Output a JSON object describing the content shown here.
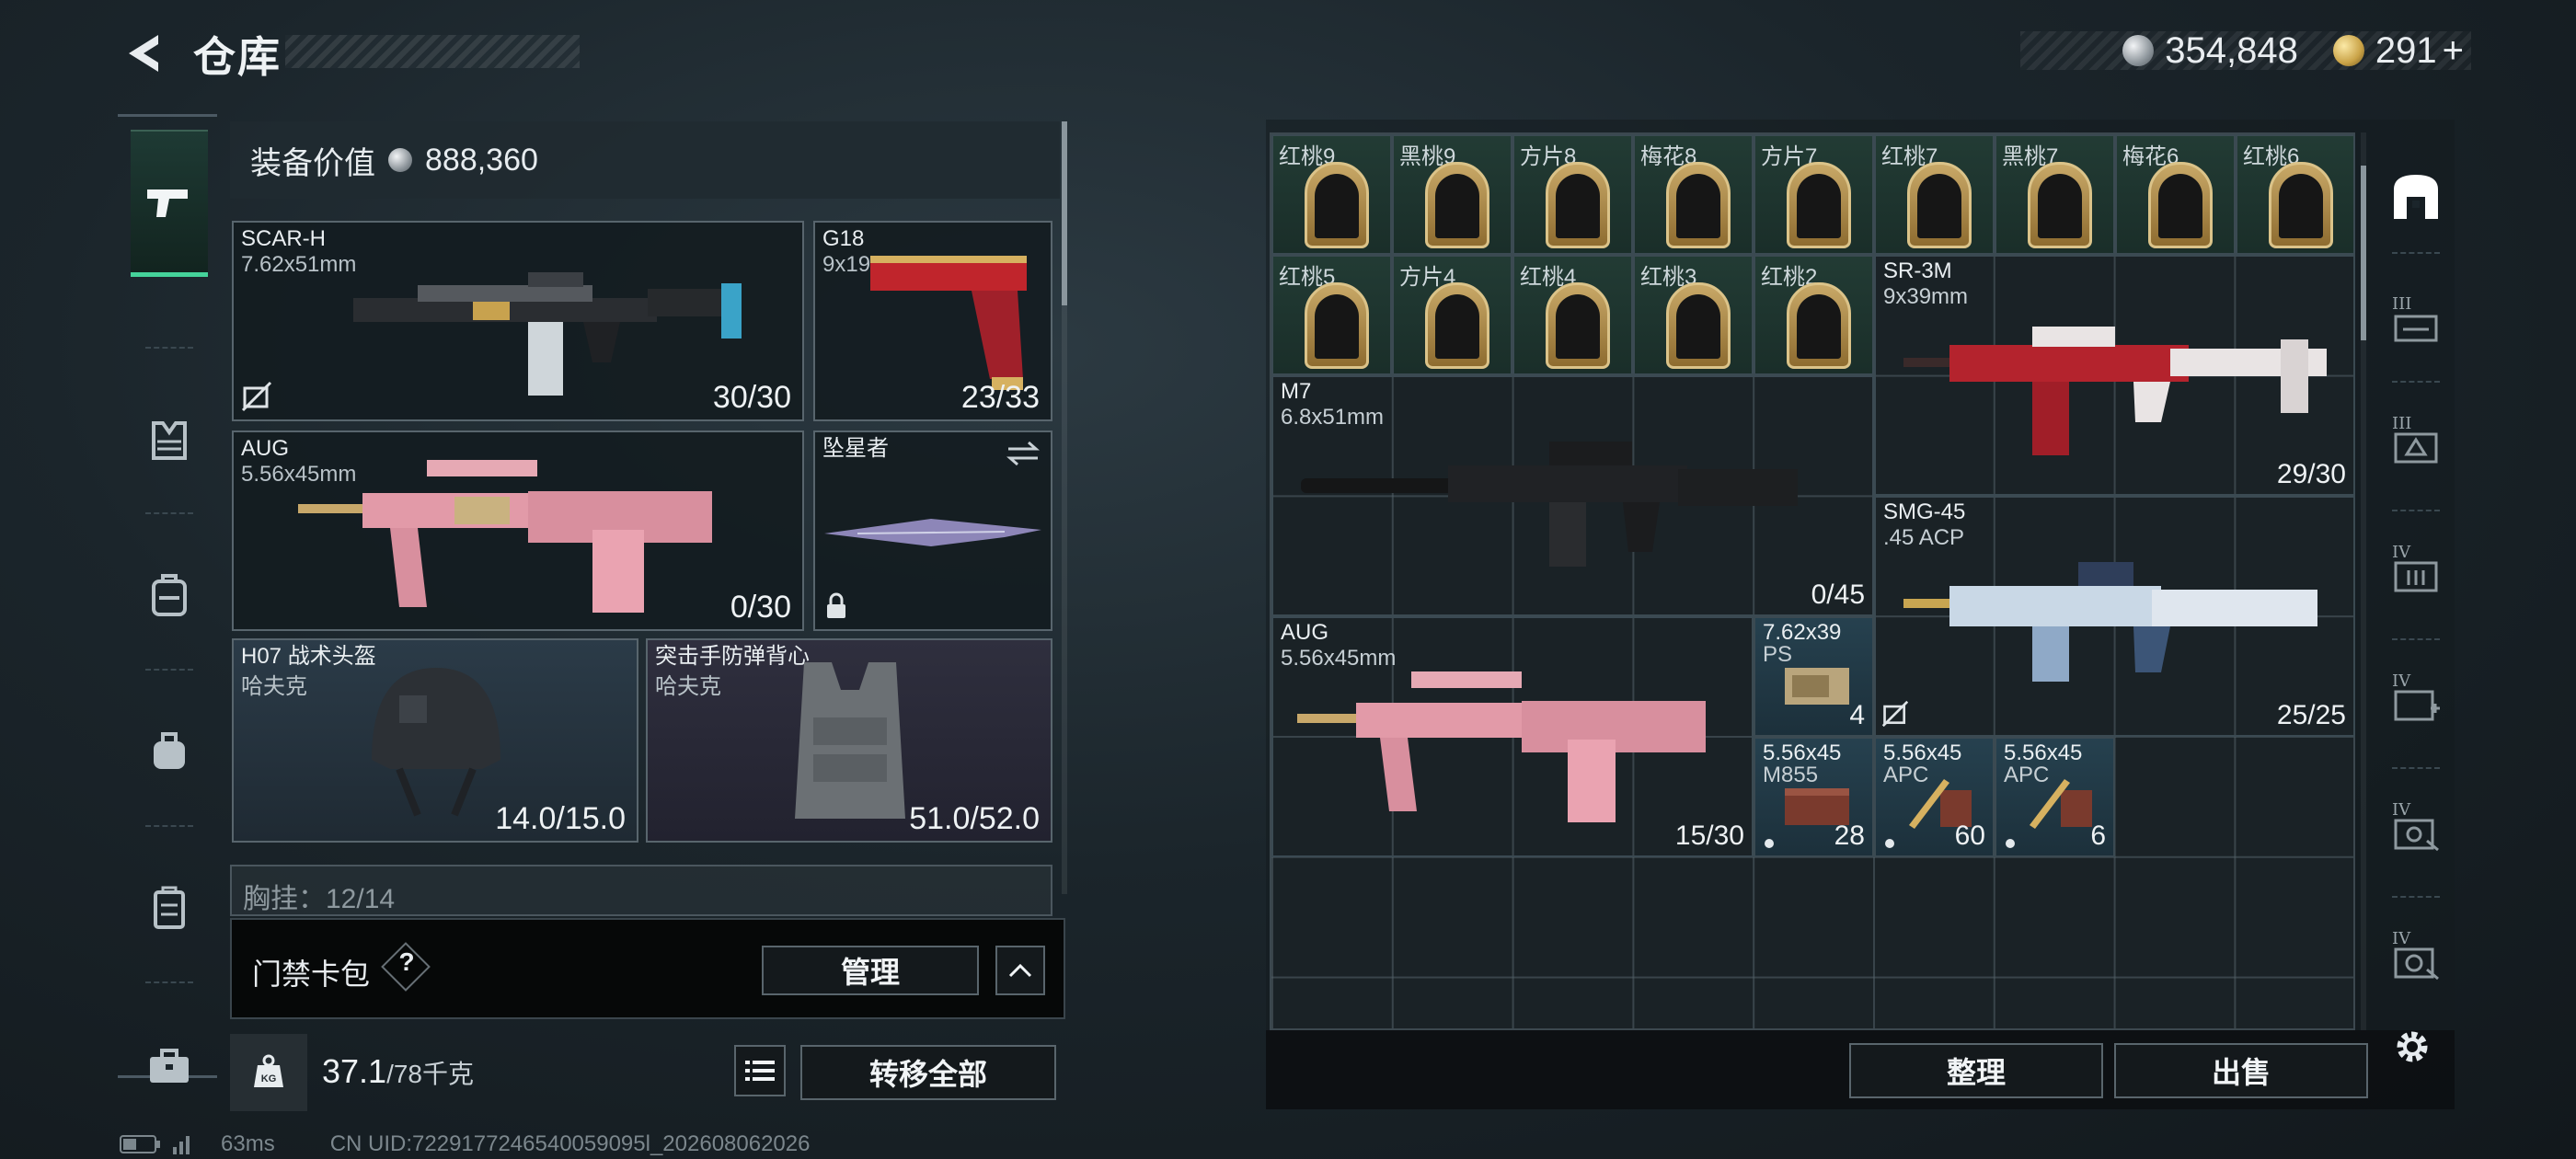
{
  "header": {
    "title": "仓库"
  },
  "currency": {
    "silver": "354,848",
    "gold": "291",
    "gold_plus": "+"
  },
  "equipment": {
    "value_label": "装备价值",
    "value": "888,360",
    "primary": {
      "name": "SCAR-H",
      "caliber": "7.62x51mm",
      "ammo": "30/30"
    },
    "pistol": {
      "name": "G18",
      "caliber": "9x19mm",
      "ammo": "23/33"
    },
    "secondary": {
      "name": "AUG",
      "caliber": "5.56x45mm",
      "ammo": "0/30"
    },
    "melee": {
      "name": "坠星者"
    },
    "helmet": {
      "name": "H07 战术头盔",
      "brand": "哈夫克",
      "durability": "14.0/15.0"
    },
    "armor": {
      "name": "突击手防弹背心",
      "brand": "哈夫克",
      "durability": "51.0/52.0"
    },
    "chest_rig": {
      "label": "胸挂：12/14"
    }
  },
  "card_pack": {
    "label": "门禁卡包",
    "help": "?",
    "manage_label": "管理"
  },
  "weight": {
    "current": "37.1",
    "max": "/78千克",
    "transfer_all_label": "转移全部"
  },
  "stash": {
    "cards_row1": [
      "红桃9",
      "黑桃9",
      "方片8",
      "梅花8",
      "方片7",
      "红桃7",
      "黑桃7",
      "梅花6",
      "红桃6"
    ],
    "cards_row2": [
      "红桃5",
      "方片4",
      "红桃4",
      "红桃3",
      "红桃2"
    ],
    "items": {
      "sr3m": {
        "name": "SR-3M",
        "caliber": "9x39mm",
        "ammo": "29/30"
      },
      "m7": {
        "name": "M7",
        "caliber": "6.8x51mm",
        "ammo": "0/45"
      },
      "smg45": {
        "name": "SMG-45",
        "caliber": ".45 ACP",
        "ammo": "25/25"
      },
      "aug": {
        "name": "AUG",
        "caliber": "5.56x45mm",
        "ammo": "15/30"
      },
      "ammo_ps": {
        "name": "7.62x39",
        "type": "PS",
        "count": "4"
      },
      "ammo_m855": {
        "name": "5.56x45",
        "type": "M855",
        "count": "28"
      },
      "ammo_apc1": {
        "name": "5.56x45",
        "type": "APC",
        "count": "60"
      },
      "ammo_apc2": {
        "name": "5.56x45",
        "type": "APC",
        "count": "6"
      }
    },
    "sort_label": "整理",
    "sell_label": "出售"
  },
  "filters": [
    "III",
    "III",
    "IV",
    "IV",
    "IV",
    "IV"
  ],
  "status": {
    "ping": "63ms",
    "uid": "CN UID:7229177246540059095l_202608062026"
  },
  "colors": {
    "accent": "#45d39a",
    "panel": "#1a2226",
    "card_green": "#223b34",
    "pink": "#e29aa8"
  }
}
